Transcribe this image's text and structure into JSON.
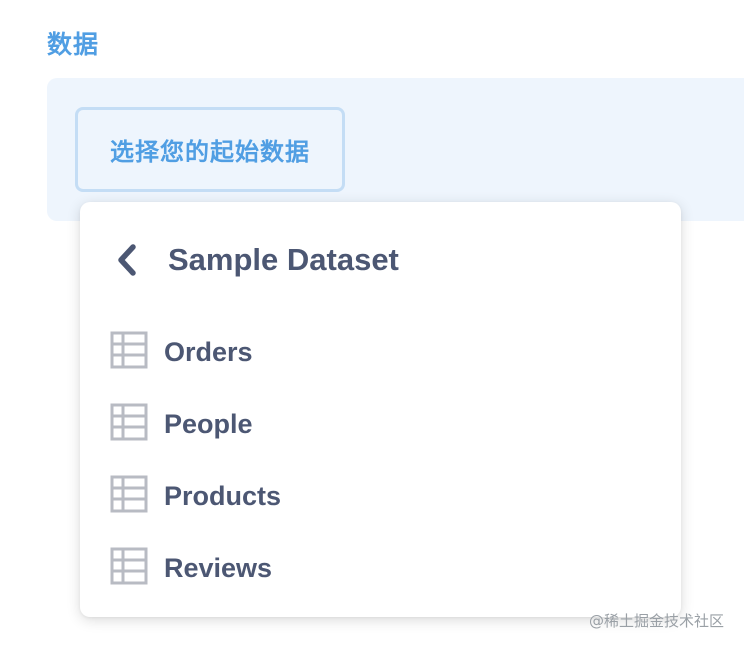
{
  "section": {
    "label": "数据"
  },
  "data_step": {
    "button_label": "选择您的起始数据"
  },
  "picker": {
    "back_icon": "chevron-left-icon",
    "database_name": "Sample Dataset",
    "tables": [
      {
        "label": "Orders",
        "icon": "table-icon"
      },
      {
        "label": "People",
        "icon": "table-icon"
      },
      {
        "label": "Products",
        "icon": "table-icon"
      },
      {
        "label": "Reviews",
        "icon": "table-icon"
      }
    ]
  },
  "watermark": {
    "text": "@稀土掘金技术社区"
  },
  "colors": {
    "brand": "#509ee3",
    "panel_bg": "#eef5fd",
    "button_border": "#c4ddf5",
    "text_dark": "#4c5773",
    "icon_gray": "#b8bbc3"
  }
}
